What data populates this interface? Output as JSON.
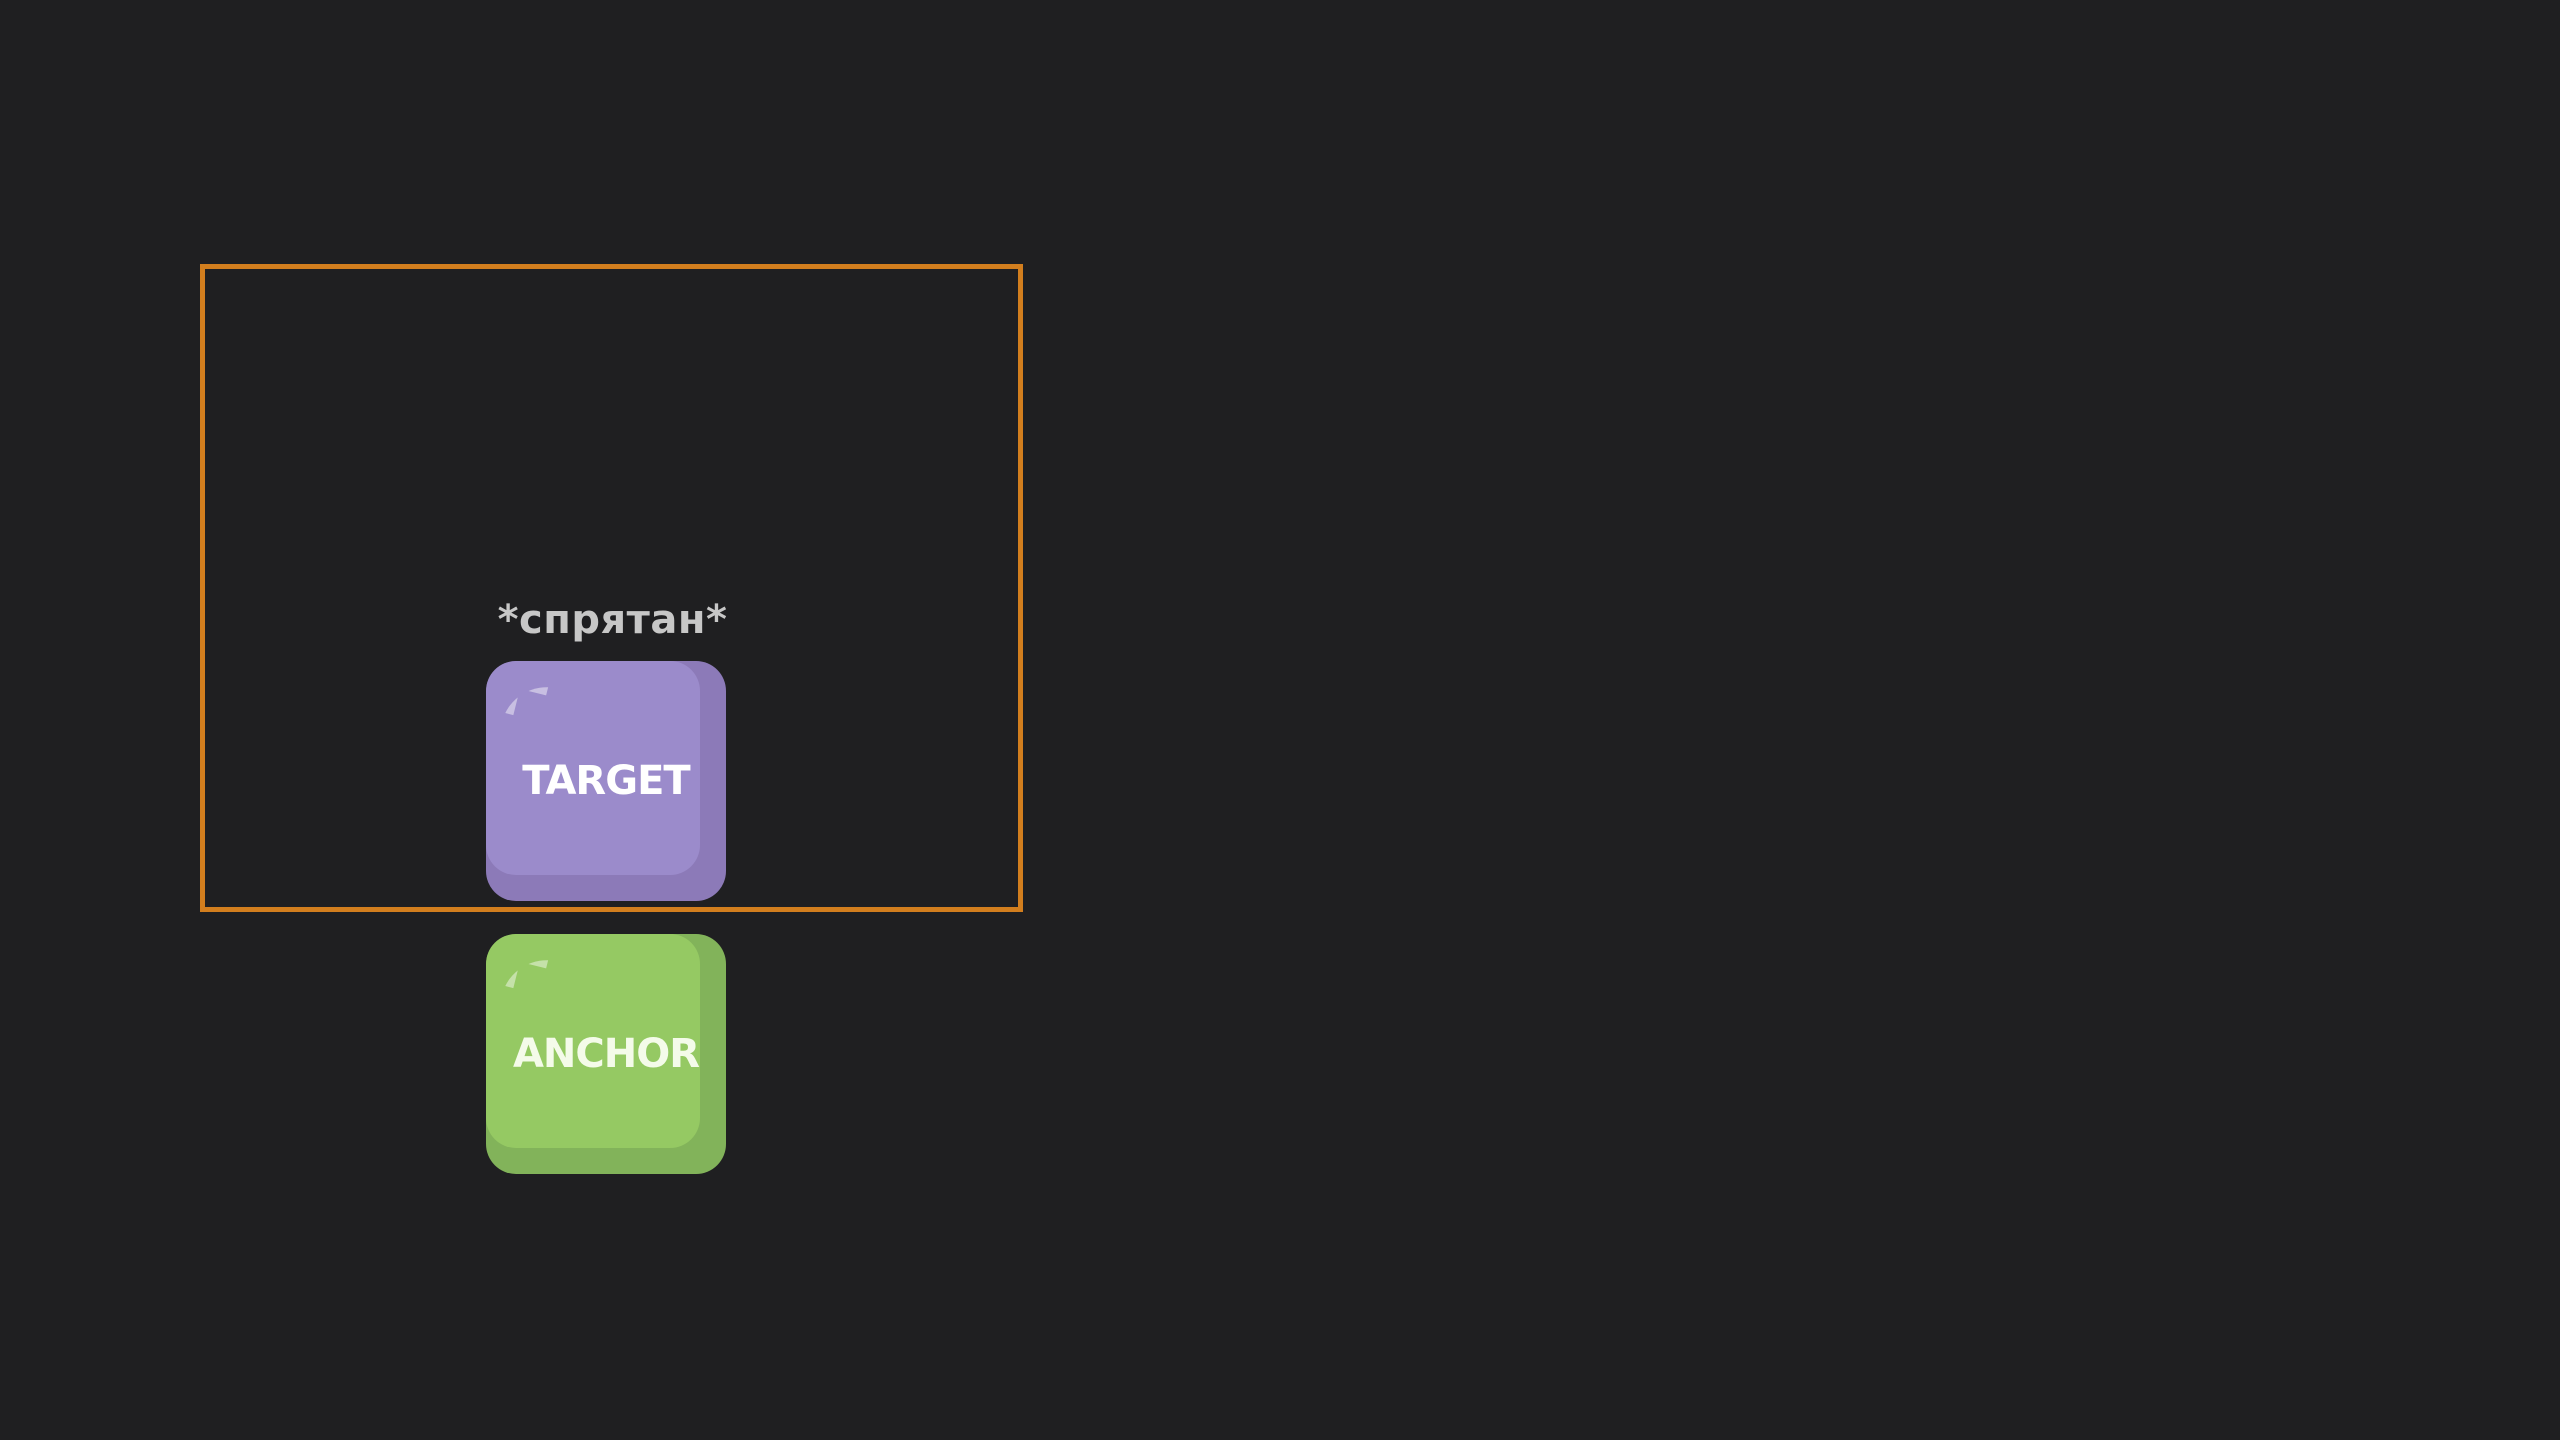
{
  "caption": "*спрятан*",
  "target": {
    "label": "TARGET",
    "color": "#9b8bcb"
  },
  "anchor": {
    "label": "ANCHOR",
    "color": "#95c963"
  },
  "frame": {
    "border_color": "#d27e1e"
  },
  "background_color": "#1f1f21"
}
